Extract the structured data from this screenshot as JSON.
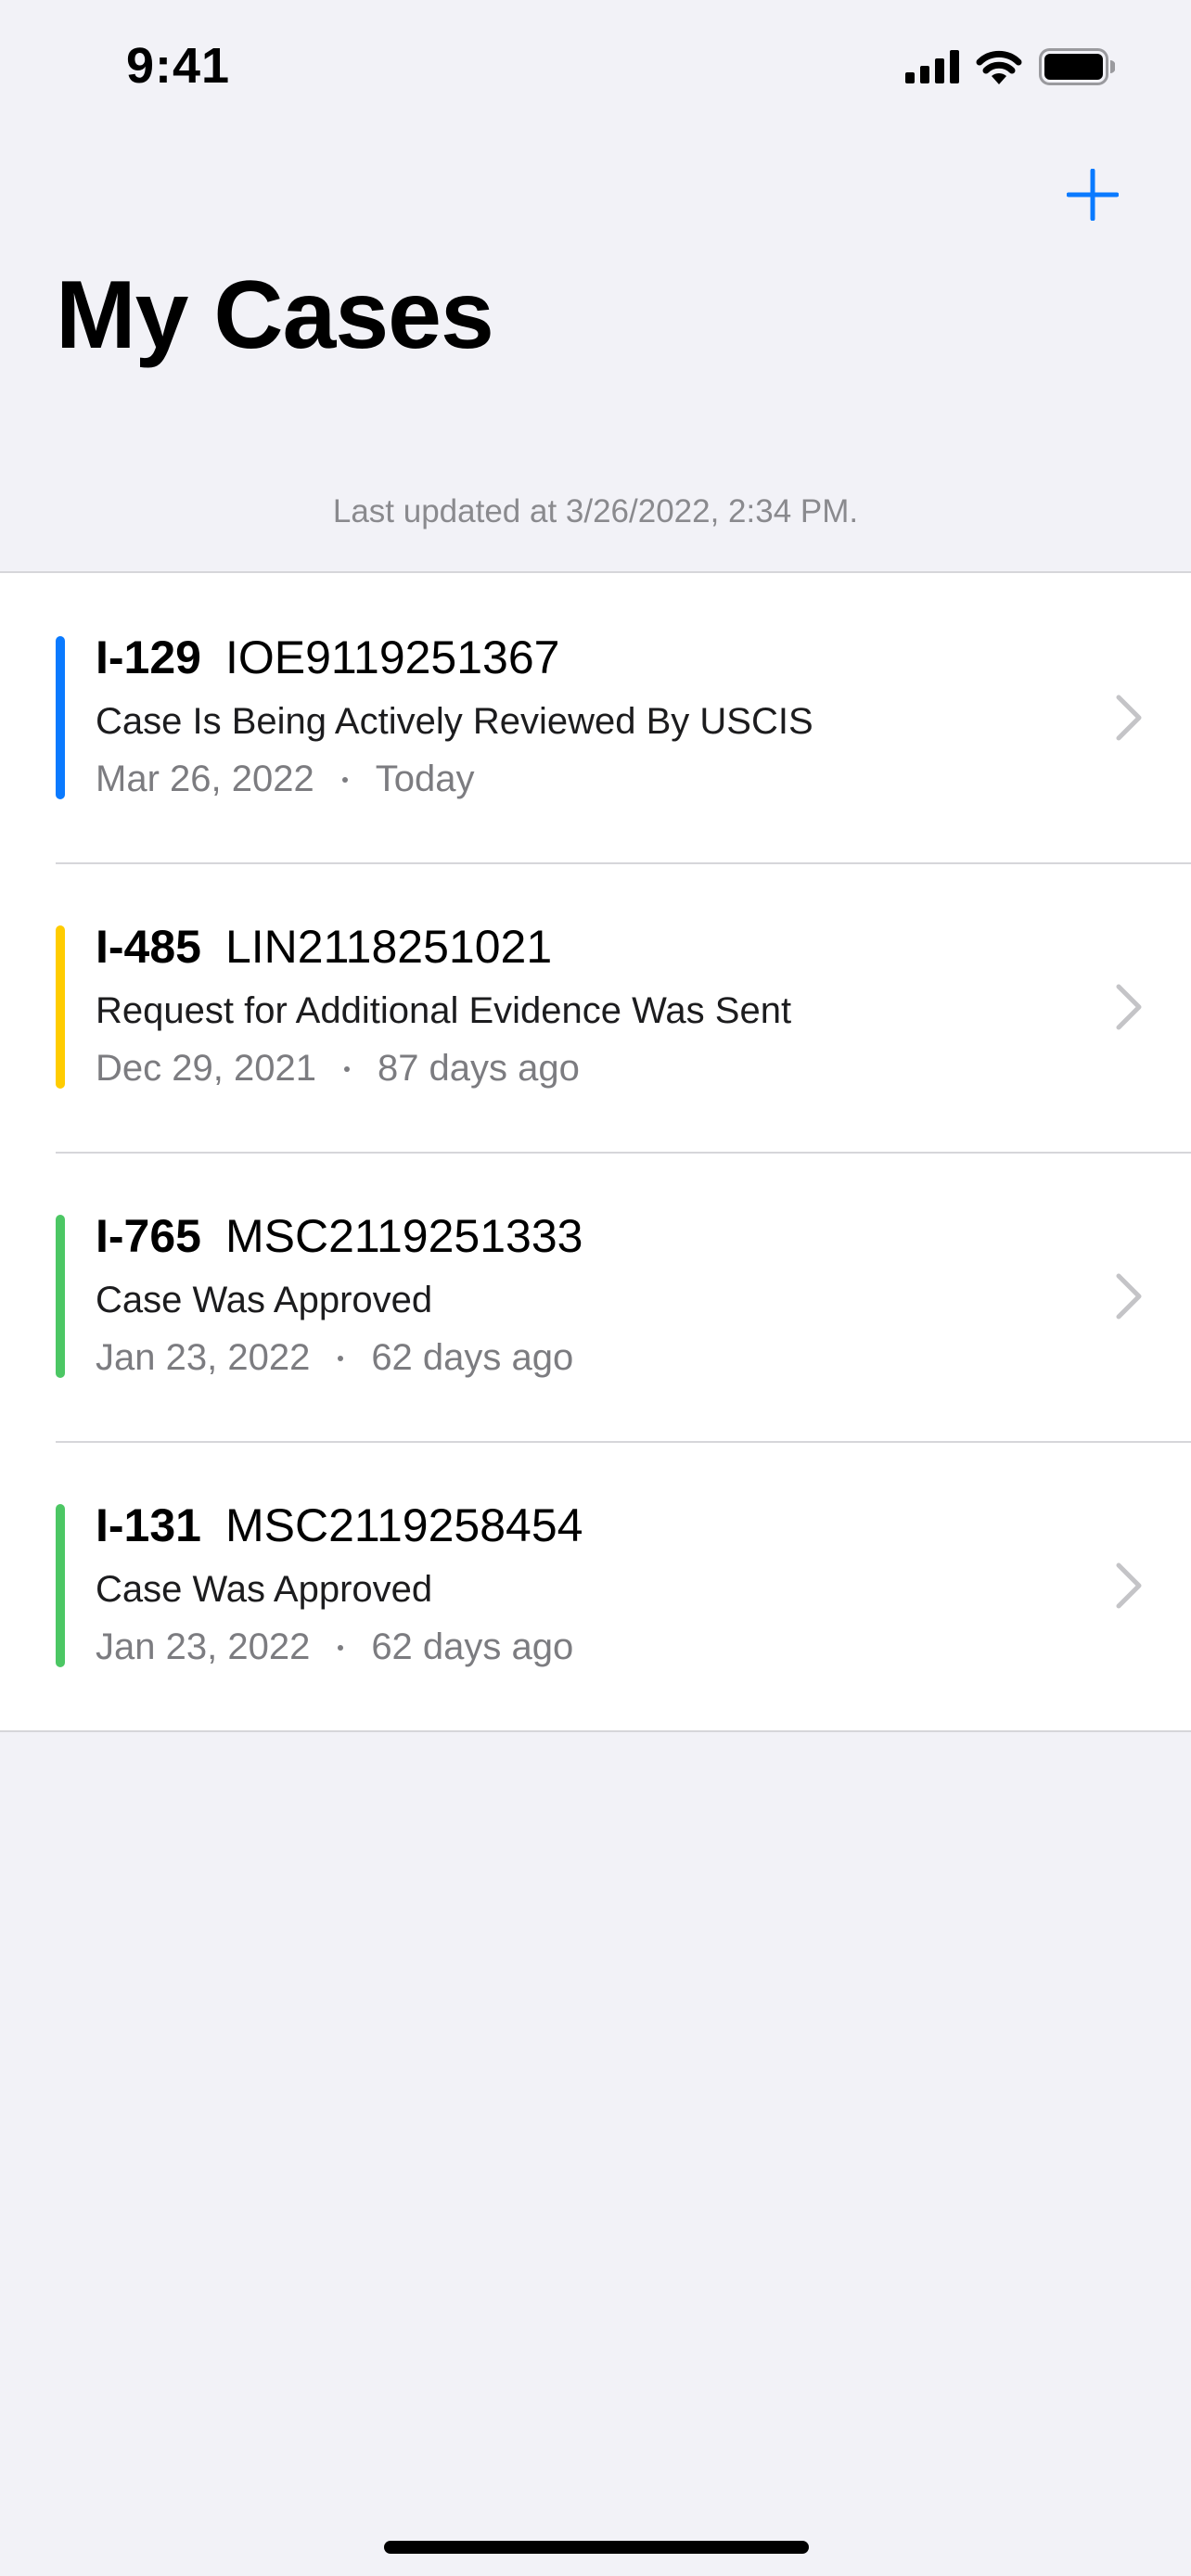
{
  "status_bar": {
    "time": "9:41"
  },
  "nav": {
    "add_icon": "plus-icon"
  },
  "title": "My Cases",
  "last_updated": "Last updated at 3/26/2022, 2:34 PM.",
  "colors": {
    "accent": "#0A7AFF",
    "blue_status": "#0A7AFF",
    "yellow_status": "#FFCC00",
    "green_status": "#4CC764"
  },
  "cases": [
    {
      "form": "I-129",
      "receipt": "IOE9119251367",
      "status": "Case Is Being Actively Reviewed By USCIS",
      "date": "Mar 26, 2022",
      "relative": "Today",
      "color": "#0A7AFF"
    },
    {
      "form": "I-485",
      "receipt": "LIN2118251021",
      "status": "Request for Additional Evidence Was Sent",
      "date": "Dec 29, 2021",
      "relative": "87 days ago",
      "color": "#FFCC00"
    },
    {
      "form": "I-765",
      "receipt": "MSC2119251333",
      "status": "Case Was Approved",
      "date": "Jan 23, 2022",
      "relative": "62 days ago",
      "color": "#4CC764"
    },
    {
      "form": "I-131",
      "receipt": "MSC2119258454",
      "status": "Case Was Approved",
      "date": "Jan 23, 2022",
      "relative": "62 days ago",
      "color": "#4CC764"
    }
  ]
}
